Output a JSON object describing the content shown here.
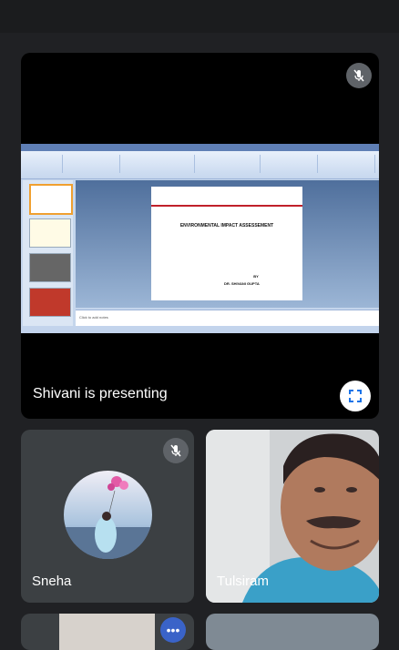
{
  "presentation": {
    "presenting_label": "Shivani is presenting",
    "slide_title": "ENVIRONMENTAL IMPACT ASSESSEMENT",
    "slide_by": "BY",
    "slide_author": "DR. SHIVANI GUPTA",
    "notes_placeholder": "Click to add notes"
  },
  "participants": [
    {
      "name": "Sneha",
      "muted": true,
      "icon": "mic-off-icon"
    },
    {
      "name": "Tulsiram",
      "muted": false
    }
  ],
  "colors": {
    "background": "#202124",
    "tile": "#3c4043",
    "accent": "#3a63c8"
  }
}
